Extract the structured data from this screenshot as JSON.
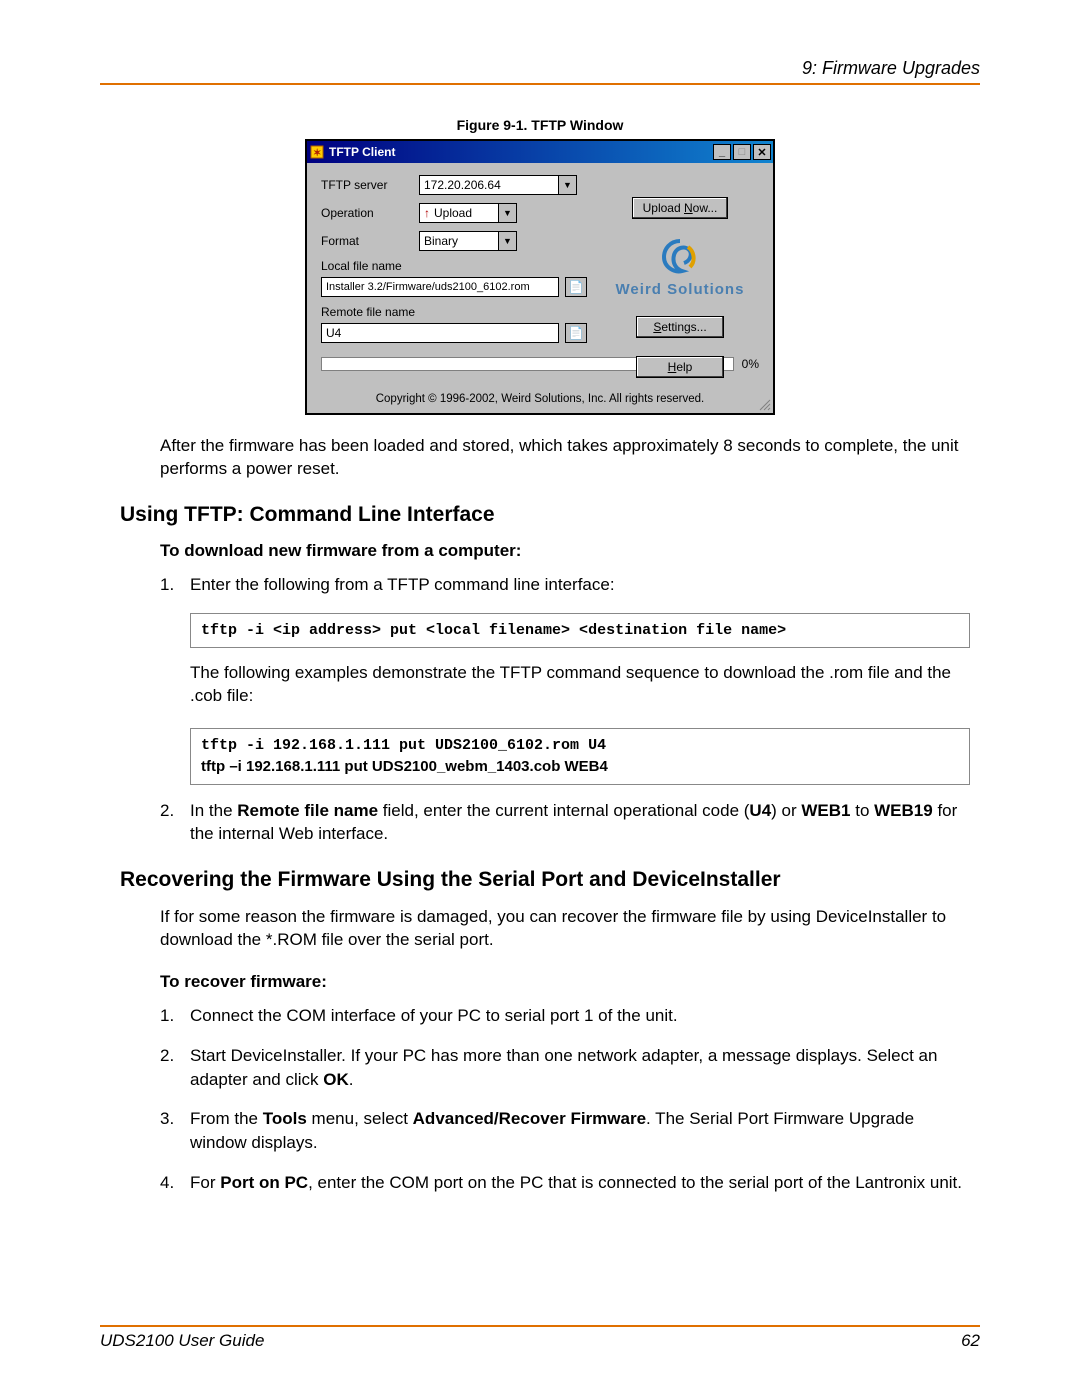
{
  "page": {
    "header": "9: Firmware Upgrades",
    "footer_left": "UDS2100 User Guide",
    "footer_right": "62"
  },
  "figure": {
    "caption": "Figure 9-1. TFTP Window"
  },
  "tftp_window": {
    "title": "TFTP Client",
    "labels": {
      "server": "TFTP server",
      "operation": "Operation",
      "format": "Format",
      "local_file": "Local file name",
      "remote_file": "Remote file name"
    },
    "values": {
      "server": "172.20.206.64",
      "operation": "Upload",
      "format": "Binary",
      "local_file": "Installer 3.2/Firmware/uds2100_6102.rom",
      "remote_file": "U4",
      "progress": "0%"
    },
    "buttons": {
      "upload_now": "Upload Now...",
      "settings": "Settings...",
      "help": "Help"
    },
    "brand": "Weird Solutions",
    "copyright": "Copyright © 1996-2002, Weird Solutions, Inc. All rights reserved."
  },
  "body": {
    "after_figure": "After the firmware has been loaded and stored, which takes approximately 8 seconds to complete, the unit performs a power reset.",
    "section1_title": "Using TFTP: Command Line Interface",
    "sub1": "To download new firmware from a computer:",
    "step1": "Enter the following from a TFTP command line interface:",
    "code1": "tftp -i <ip address> put <local filename> <destination file name>",
    "after_code1": "The following examples demonstrate the TFTP command sequence to download the .rom file and the .cob file:",
    "code2_line1": "tftp -i 192.168.1.111 put UDS2100_6102.rom U4",
    "code2_line2": "tftp –i 192.168.1.111 put UDS2100_webm_1403.cob WEB4",
    "step2_pre": "In the ",
    "step2_b1": "Remote file name",
    "step2_mid": " field, enter the current internal operational code (",
    "step2_b2": "U4",
    "step2_mid2": ") or ",
    "step2_b3": "WEB1",
    "step2_mid3": " to ",
    "step2_b4": "WEB19",
    "step2_end": " for the internal Web interface.",
    "section2_title": "Recovering the Firmware Using the Serial Port and DeviceInstaller",
    "recover_intro": "If for some reason the firmware is damaged, you can recover the firmware file by using DeviceInstaller to download the *.ROM file over the serial port.",
    "sub2": "To recover firmware:",
    "r1": "Connect the COM interface of your PC to serial port 1 of the unit.",
    "r2_pre": "Start DeviceInstaller. If your PC has more than one network adapter, a message displays. Select an adapter and click ",
    "r2_b": "OK",
    "r2_end": ".",
    "r3_pre": "From the ",
    "r3_b1": "Tools",
    "r3_mid": " menu, select ",
    "r3_b2": "Advanced/Recover Firmware",
    "r3_end": ". The Serial Port Firmware Upgrade window displays.",
    "r4_pre": "For ",
    "r4_b": "Port on PC",
    "r4_end": ", enter the COM port on the PC that is connected to the serial port of the Lantronix unit."
  }
}
